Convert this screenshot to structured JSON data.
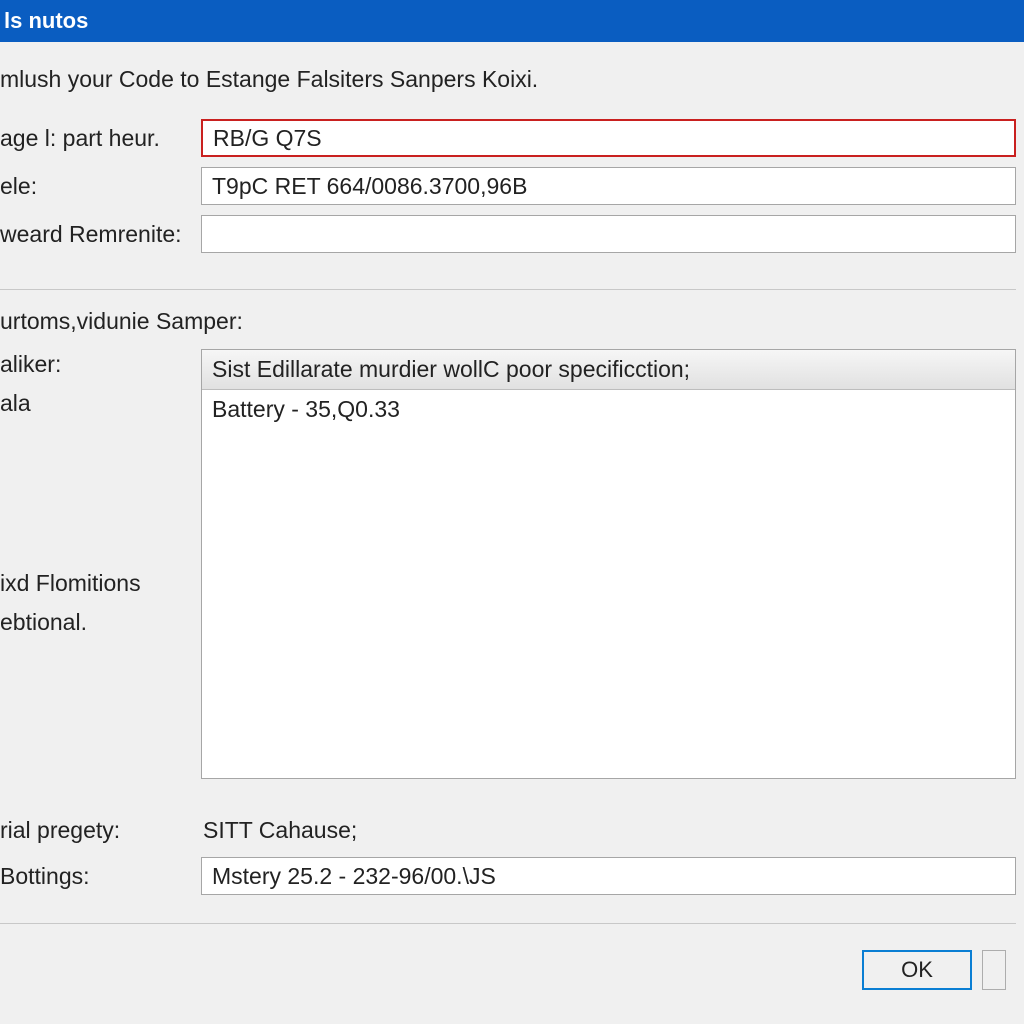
{
  "window": {
    "title": "ls nutos"
  },
  "description": "mlush your Code to Estange Falsiters Sanpers Koixi.",
  "fields": {
    "part_heur": {
      "label": "age l: part heur.",
      "value": "RB/G Q7S"
    },
    "ele": {
      "label": "ele:",
      "value": "T9pC RET 664/0086.3700,96B"
    },
    "remrente": {
      "label": "weard Remrenite:",
      "value": ""
    }
  },
  "samper": {
    "section_label": "urtoms,vidunie Samper:",
    "left_labels": [
      "aliker:",
      "ala",
      "ixd Flomitions",
      "ebtional."
    ],
    "header": "Sist Edillarate murdier wollC poor specificction;",
    "items": [
      "Battery - 35,Q0.33"
    ]
  },
  "bottom": {
    "pregety": {
      "label": "rial pregety:",
      "value": "SITT Cahause;"
    },
    "bottings": {
      "label": "Bottings:",
      "value": "Mstery 25.2 - 232-96/00.\\JS"
    }
  },
  "buttons": {
    "ok": "OK"
  }
}
